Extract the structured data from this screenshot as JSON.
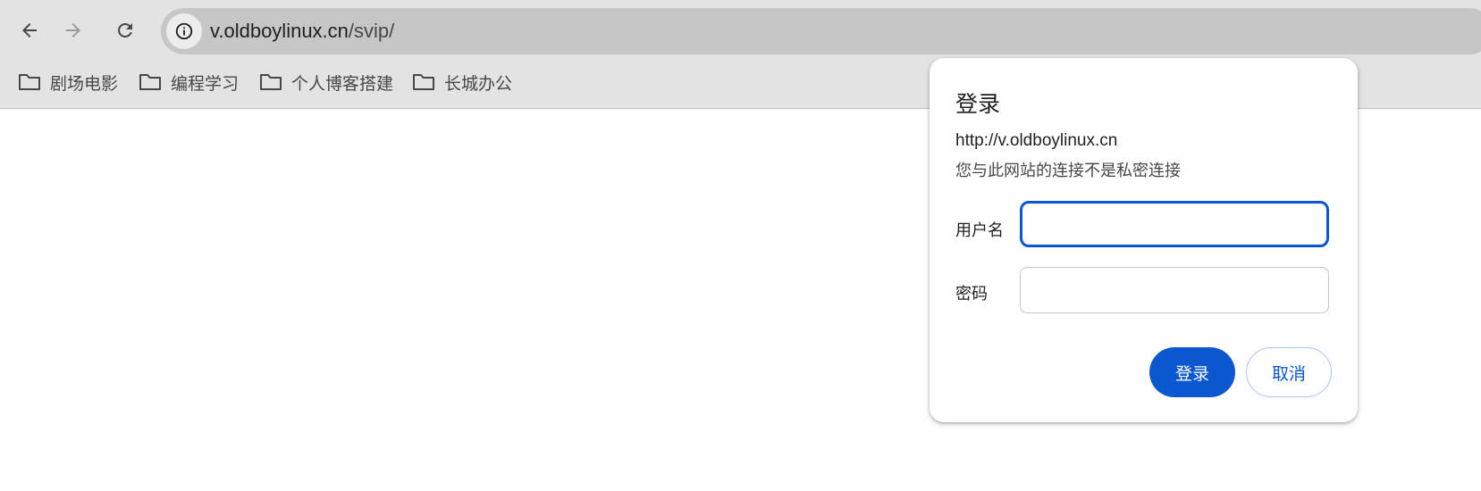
{
  "browser": {
    "url": {
      "host": "v.oldboylinux.cn",
      "path": "/svip/"
    },
    "bookmarks": [
      {
        "label": "剧场电影",
        "icon": "folder-icon"
      },
      {
        "label": "编程学习",
        "icon": "folder-icon"
      },
      {
        "label": "个人博客搭建",
        "icon": "folder-icon"
      },
      {
        "label": "长城办公",
        "icon": "folder-icon"
      }
    ]
  },
  "auth_dialog": {
    "title": "登录",
    "origin": "http://v.oldboylinux.cn",
    "warning": "您与此网站的连接不是私密连接",
    "username_label": "用户名",
    "username_value": "",
    "password_label": "密码",
    "password_value": "",
    "sign_in_label": "登录",
    "cancel_label": "取消"
  },
  "colors": {
    "accent": "#0b57d0",
    "chrome_bg": "#e3e3e3",
    "omnibox_bg": "#c6c6c6"
  }
}
